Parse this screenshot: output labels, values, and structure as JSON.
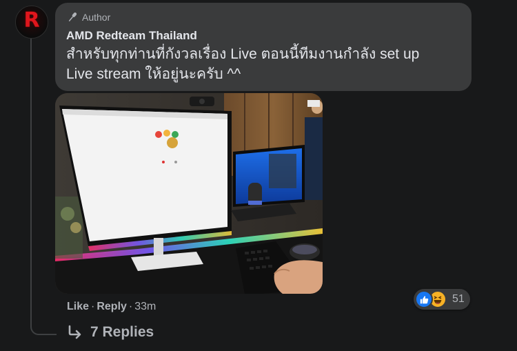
{
  "comment": {
    "badge_label": "Author",
    "author_name": "AMD Redteam Thailand",
    "text": "สำหรับทุกท่านที่กังวลเรื่อง Live ตอนนี้ทีมงานกำลัง set up\nLive stream ให้อยู่นะครับ ^^",
    "avatar_letter": "R"
  },
  "actions": {
    "like_label": "Like",
    "dot": "·",
    "reply_label": "Reply",
    "timestamp": "33m"
  },
  "reactions": {
    "icons": [
      "like-icon",
      "haha-icon"
    ],
    "count": "51"
  },
  "replies": {
    "label": "7 Replies"
  },
  "colors": {
    "background": "#18191a",
    "bubble": "#3a3b3c",
    "text_primary": "#e4e6eb",
    "text_secondary": "#b0b3b8",
    "like_blue": "#1877f2",
    "haha_yellow": "#f7b125",
    "brand_red": "#e0161d"
  }
}
